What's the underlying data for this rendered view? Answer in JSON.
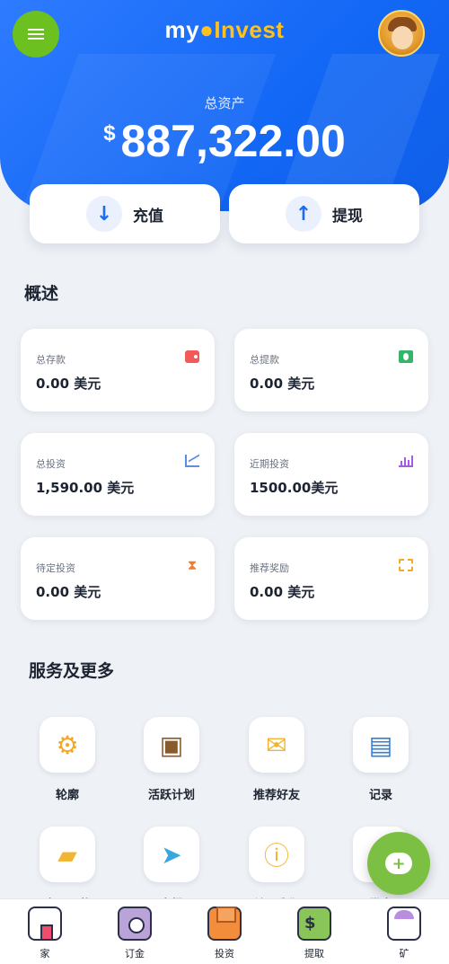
{
  "header": {
    "brand_part1": "my",
    "brand_part2": "Invest",
    "asset_label": "总资产",
    "currency_symbol": "$",
    "asset_value": "887,322.00"
  },
  "actions": {
    "recharge_label": "充值",
    "withdraw_label": "提现"
  },
  "overview": {
    "title": "概述",
    "cards": [
      {
        "label": "总存款",
        "value": "0.00 美元",
        "icon": "wallet-icon"
      },
      {
        "label": "总提款",
        "value": "0.00 美元",
        "icon": "money-icon"
      },
      {
        "label": "总投资",
        "value": "1,590.00 美元",
        "icon": "line-chart-icon"
      },
      {
        "label": "近期投资",
        "value": "1500.00美元",
        "icon": "bar-chart-icon"
      },
      {
        "label": "待定投资",
        "value": "0.00 美元",
        "icon": "hourglass-icon"
      },
      {
        "label": "推荐奖励",
        "value": "0.00 美元",
        "icon": "scan-icon"
      }
    ]
  },
  "services": {
    "title": "服务及更多",
    "items": [
      {
        "label": "轮廓",
        "icon": "gear-icon"
      },
      {
        "label": "活跃计划",
        "icon": "package-icon"
      },
      {
        "label": "推荐好友",
        "icon": "envelope-heart-icon"
      },
      {
        "label": "记录",
        "icon": "clipboard-icon"
      },
      {
        "label": "应用下载",
        "icon": "download-folder-icon"
      },
      {
        "label": "电报",
        "icon": "telegram-icon"
      },
      {
        "label": "关于我们",
        "icon": "info-icon"
      },
      {
        "label": "登出",
        "icon": "logout-icon"
      }
    ]
  },
  "bottom_nav": [
    {
      "label": "家",
      "icon": "home-icon"
    },
    {
      "label": "订金",
      "icon": "safe-icon"
    },
    {
      "label": "投资",
      "icon": "boxes-icon"
    },
    {
      "label": "提取",
      "icon": "wallet-icon"
    },
    {
      "label": "矿",
      "icon": "miner-icon"
    }
  ],
  "colors": {
    "primary_blue": "#1267f5",
    "accent_green": "#6cc01f",
    "brand_yellow": "#ffc21a"
  }
}
